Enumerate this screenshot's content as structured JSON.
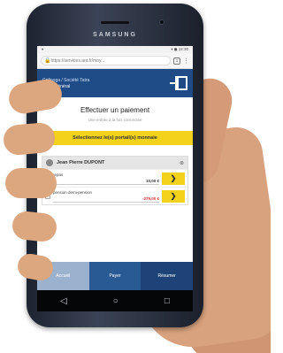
{
  "device": {
    "brand": "SAMSUNG"
  },
  "statusbar": {
    "left": "▾",
    "right": "▾ ◼ 12:30"
  },
  "browser": {
    "lock": "🔒",
    "url": "https://services.ant.fr/moy...",
    "tabs": "1",
    "menu": "⋮"
  },
  "header": {
    "line1": "Cofinoga / Société Tatra",
    "line2": "Lycée général"
  },
  "page": {
    "title": "Effectuer un paiement",
    "subtitle": "Une entrée à la fois connectée",
    "banner": "Sélectionnez le(s) portail(s) monnaie"
  },
  "card": {
    "person": "Jean Pierre DUPONT",
    "close": "⊗",
    "items": [
      {
        "label": "repas",
        "amount": "10,00 €",
        "amount_color": "dark"
      },
      {
        "label": "pension demi-pension",
        "amount": "-279,00 €",
        "amount_color": "red"
      }
    ],
    "go_symbol": "❯"
  },
  "footer": {
    "b1": "Accueil",
    "b2": "Payer",
    "b3": "Résumer"
  },
  "navbar": {
    "back": "◁",
    "home": "○",
    "recent": "□"
  }
}
